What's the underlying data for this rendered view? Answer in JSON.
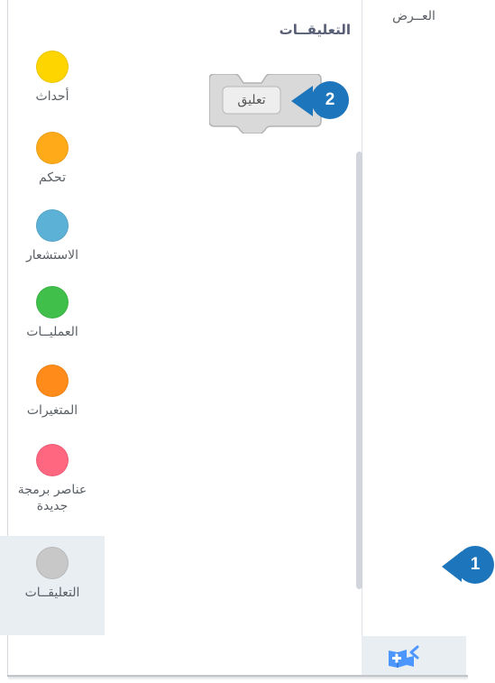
{
  "palette": {
    "title": "التعليقــات",
    "block_label": "تعليق"
  },
  "top_category": "العــرض",
  "categories": [
    {
      "label": "أحداث",
      "color": "#ffd500"
    },
    {
      "label": "تحكم",
      "color": "#ffab19"
    },
    {
      "label": "الاستشعار",
      "color": "#5cb1d6"
    },
    {
      "label": "العمليــات",
      "color": "#40bf4a"
    },
    {
      "label": "المتغيرات",
      "color": "#ff8c1a"
    },
    {
      "label": "عناصر برمجة جديدة",
      "color": "#ff6680"
    },
    {
      "label": "التعليقــات",
      "color": "#c8c8c8",
      "selected": true
    }
  ],
  "badges": {
    "one": "1",
    "two": "2"
  },
  "colors": {
    "badge": "#1d75bc",
    "block_fill": "#d9d9d9",
    "block_border": "#b3b3b3"
  },
  "icons": {
    "extensions": "add-extension-icon"
  }
}
